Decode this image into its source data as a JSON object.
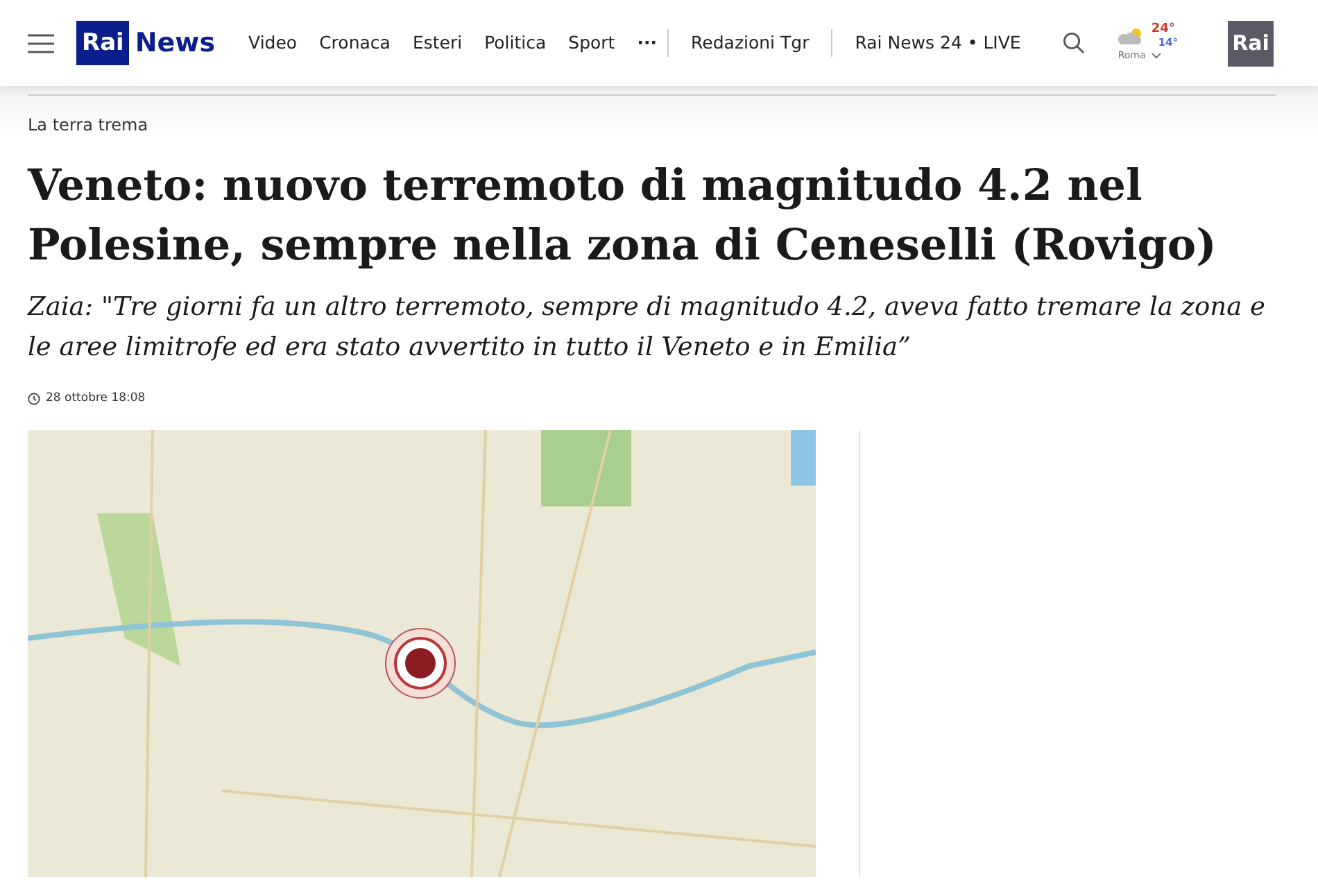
{
  "header": {
    "logo": {
      "brand": "Rai",
      "product": "News"
    },
    "nav": [
      "Video",
      "Cronaca",
      "Esteri",
      "Politica",
      "Sport"
    ],
    "more": "···",
    "links": [
      "Redazioni Tgr",
      "Rai News 24 • LIVE"
    ],
    "weather": {
      "max": "24°",
      "min": "14°",
      "city": "Roma"
    },
    "corner_logo": "Rai"
  },
  "article": {
    "kicker": "La terra trema",
    "title": "Veneto: nuovo terremoto di magnitudo 4.2 nel Polesine, sempre nella zona di Ceneselli (Rovigo)",
    "subtitle": "Zaia: \"Tre giorni fa un altro terremoto, sempre di magnitudo 4.2, aveva fatto tremare la zona e le aree limitrofe ed era stato avvertito in tutto il Veneto e in Emilia”",
    "date": "28 ottobre 18:08"
  }
}
